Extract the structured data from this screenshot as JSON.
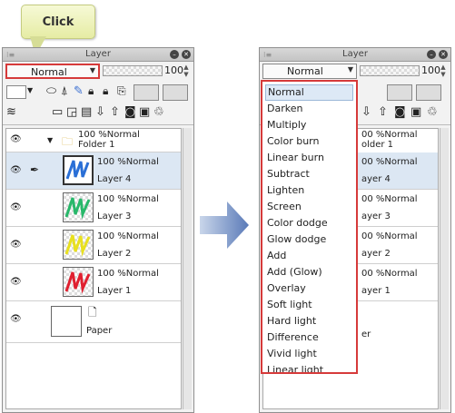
{
  "callout": {
    "text": "Click"
  },
  "left_panel": {
    "title": "Layer",
    "blend_mode": "Normal",
    "opacity": "100",
    "layers": [
      {
        "info": "100 %Normal",
        "name": "Folder 1",
        "type": "folder"
      },
      {
        "info": "100 %Normal",
        "name": "Layer 4",
        "selected": true,
        "color": "#2a6fd6"
      },
      {
        "info": "100 %Normal",
        "name": "Layer 3",
        "color": "#28b86a"
      },
      {
        "info": "100 %Normal",
        "name": "Layer 2",
        "color": "#e8e020"
      },
      {
        "info": "100 %Normal",
        "name": "Layer 1",
        "color": "#e02030"
      }
    ],
    "paper": {
      "name": "Paper"
    }
  },
  "right_panel": {
    "title": "Layer",
    "blend_mode": "Normal",
    "opacity": "100",
    "partial_layers": [
      {
        "info": "00 %Normal",
        "name": "older 1"
      },
      {
        "info": "00 %Normal",
        "name": "ayer 4"
      },
      {
        "info": "00 %Normal",
        "name": "ayer 3"
      },
      {
        "info": "00 %Normal",
        "name": "ayer 2"
      },
      {
        "info": "00 %Normal",
        "name": "ayer 1"
      },
      {
        "info": "",
        "name": "er"
      }
    ]
  },
  "blend_options": [
    "Normal",
    "Darken",
    "Multiply",
    "Color burn",
    "Linear burn",
    "Subtract",
    "Lighten",
    "Screen",
    "Color dodge",
    "Glow dodge",
    "Add",
    "Add (Glow)",
    "Overlay",
    "Soft light",
    "Hard light",
    "Difference",
    "Vivid light",
    "Linear light"
  ],
  "icons": {
    "eye": "eye-icon",
    "folder": "folder-icon",
    "pen": "pen-icon"
  }
}
